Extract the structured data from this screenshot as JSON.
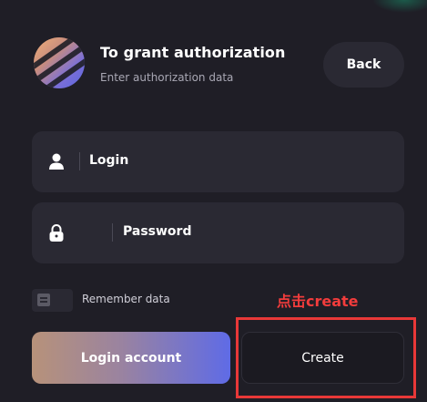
{
  "header": {
    "title": "To grant authorization",
    "subtitle": "Enter authorization data",
    "back_label": "Back",
    "logo_icon": "striped-sphere-logo"
  },
  "form": {
    "login_value": "Login",
    "login_icon": "user-icon",
    "password_value": "Password",
    "password_icon": "lock-icon",
    "remember_label": "Remember data"
  },
  "actions": {
    "login_account_label": "Login account",
    "create_label": "Create"
  },
  "annotation": {
    "text": "点击create",
    "color": "#f23c3c"
  },
  "colors": {
    "background": "#1f1e26",
    "field": "#2a2933",
    "accent_gradient_start": "#b7927a",
    "accent_gradient_end": "#5f6be6",
    "highlight": "#e83838"
  }
}
